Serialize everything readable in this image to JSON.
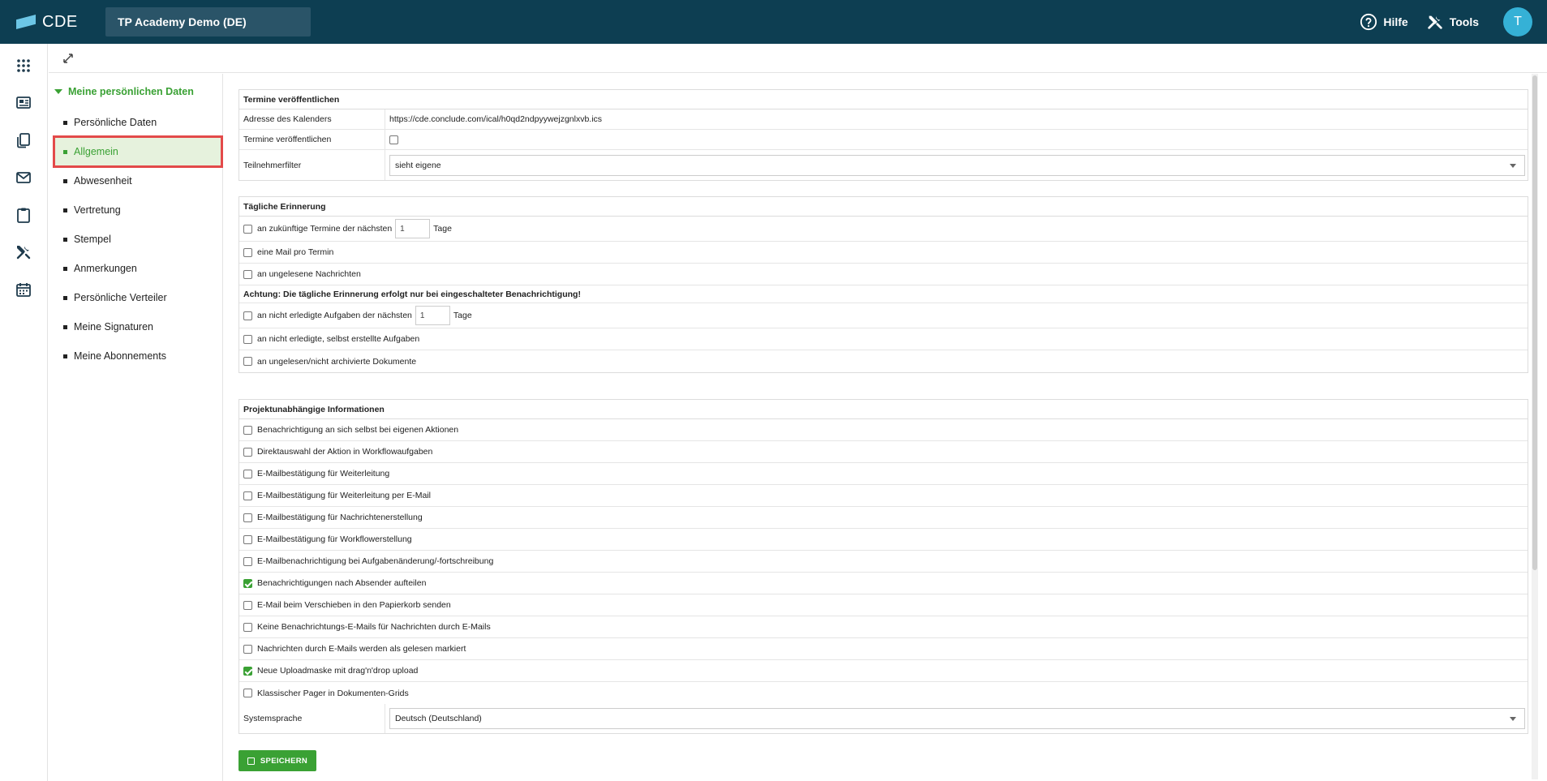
{
  "app": {
    "logo_text": "CDE",
    "project": "TP Academy Demo (DE)"
  },
  "topbar": {
    "help_label": "Hilfe",
    "tools_label": "Tools",
    "avatar_initial": "T"
  },
  "tree": {
    "root_label": "Meine persönlichen Daten",
    "items": [
      {
        "label": "Persönliche Daten"
      },
      {
        "label": "Allgemein"
      },
      {
        "label": "Abwesenheit"
      },
      {
        "label": "Vertretung"
      },
      {
        "label": "Stempel"
      },
      {
        "label": "Anmerkungen"
      },
      {
        "label": "Persönliche Verteiler"
      },
      {
        "label": "Meine Signaturen"
      },
      {
        "label": "Meine Abonnements"
      }
    ]
  },
  "termine": {
    "title": "Termine veröffentlichen",
    "address_label": "Adresse des Kalenders",
    "address_value": "https://cde.conclude.com/ical/h0qd2ndpyywejzgnlxvb.ics",
    "publish_label": "Termine veröffentlichen",
    "filter_label": "Teilnehmerfilter",
    "filter_value": "sieht eigene"
  },
  "erinnerung": {
    "title": "Tägliche Erinnerung",
    "future_label": "an zukünftige Termine der nächsten",
    "future_days": "1",
    "days_unit": "Tage",
    "one_mail_label": "eine Mail pro Termin",
    "unread_label": "an ungelesene Nachrichten",
    "warning": "Achtung: Die tägliche Erinnerung erfolgt nur bei eingeschalteter Benachrichtigung!",
    "tasks_label": "an nicht erledigte Aufgaben der nächsten",
    "tasks_days": "1",
    "self_tasks_label": "an nicht erledigte, selbst erstellte Aufgaben",
    "docs_label": "an ungelesen/nicht archivierte Dokumente"
  },
  "projekt": {
    "title": "Projektunabhängige Informationen",
    "options": [
      {
        "label": "Benachrichtigung an sich selbst bei eigenen Aktionen",
        "checked": false
      },
      {
        "label": "Direktauswahl der Aktion in Workflowaufgaben",
        "checked": false
      },
      {
        "label": "E-Mailbestätigung für Weiterleitung",
        "checked": false
      },
      {
        "label": "E-Mailbestätigung für Weiterleitung per E-Mail",
        "checked": false
      },
      {
        "label": "E-Mailbestätigung für Nachrichtenerstellung",
        "checked": false
      },
      {
        "label": "E-Mailbestätigung für Workflowerstellung",
        "checked": false
      },
      {
        "label": "E-Mailbenachrichtigung bei Aufgabenänderung/-fortschreibung",
        "checked": false
      },
      {
        "label": "Benachrichtigungen nach Absender aufteilen",
        "checked": true
      },
      {
        "label": "E-Mail beim Verschieben in den Papierkorb senden",
        "checked": false
      },
      {
        "label": "Keine Benachrichtungs-E-Mails für Nachrichten durch E-Mails",
        "checked": false
      },
      {
        "label": "Nachrichten durch E-Mails werden als gelesen markiert",
        "checked": false
      },
      {
        "label": "Neue Uploadmaske mit drag'n'drop upload",
        "checked": true
      },
      {
        "label": "Klassischer Pager in Dokumenten-Grids",
        "checked": false
      }
    ],
    "lang_label": "Systemsprache",
    "lang_value": "Deutsch (Deutschland)"
  },
  "actions": {
    "save_label": "SPEICHERN"
  },
  "colors": {
    "topbar": "#0d3e52",
    "accent": "#3aa134",
    "highlight": "#e34a4a"
  }
}
